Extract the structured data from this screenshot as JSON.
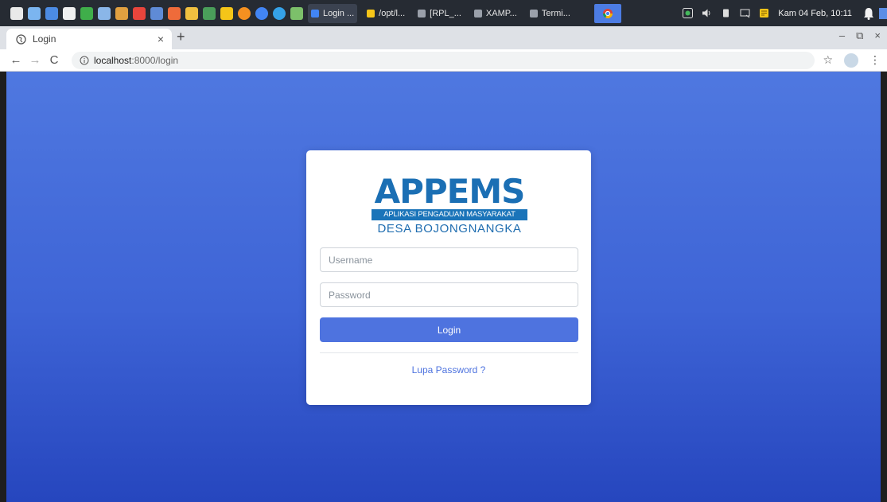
{
  "taskbar": {
    "windows": [
      {
        "label": "Login ...",
        "color": "#4285f4"
      },
      {
        "label": "/opt/l...",
        "color": "#f5c518"
      },
      {
        "label": "[RPL_...",
        "color": "#9aa0aa"
      },
      {
        "label": "XAMP...",
        "color": "#9aa0aa"
      },
      {
        "label": "Termi...",
        "color": "#9aa0aa"
      }
    ],
    "clock": "Kam 04 Feb, 10:11",
    "launcher_colors": [
      "#e9e9e9",
      "#7bb5f0",
      "#4c8be3",
      "#f0f0f0",
      "#3fae4a",
      "#8ab6e8",
      "#e0a040",
      "#e8453c",
      "#5f8bd6",
      "#ef6b3a",
      "#f0c040",
      "#4a9e5a",
      "#f5c518",
      "#f59020",
      "#4285f4",
      "#35a2e8",
      "#7cc06a"
    ]
  },
  "browser": {
    "tab_title": "Login",
    "new_tab": "+",
    "tab_close": "×",
    "url_host": "localhost",
    "url_path": ":8000/login",
    "win_minimize": "–",
    "win_restore": "⧉",
    "win_close": "×",
    "back": "←",
    "forward": "→",
    "reload": "C",
    "bookmark": "☆",
    "menu": "⋮"
  },
  "login": {
    "logo_word": "APPEMS",
    "logo_band": "APLIKASI PENGADUAN MASYARAKAT",
    "logo_sub": "DESA BOJONGNANGKA",
    "username_placeholder": "Username",
    "password_placeholder": "Password",
    "button_label": "Login",
    "forgot_label": "Lupa Password ?"
  },
  "colors": {
    "primary": "#4e73df",
    "logo_blue": "#1b6fb4",
    "bg_top": "#4f78e0",
    "bg_bottom": "#2646be"
  }
}
